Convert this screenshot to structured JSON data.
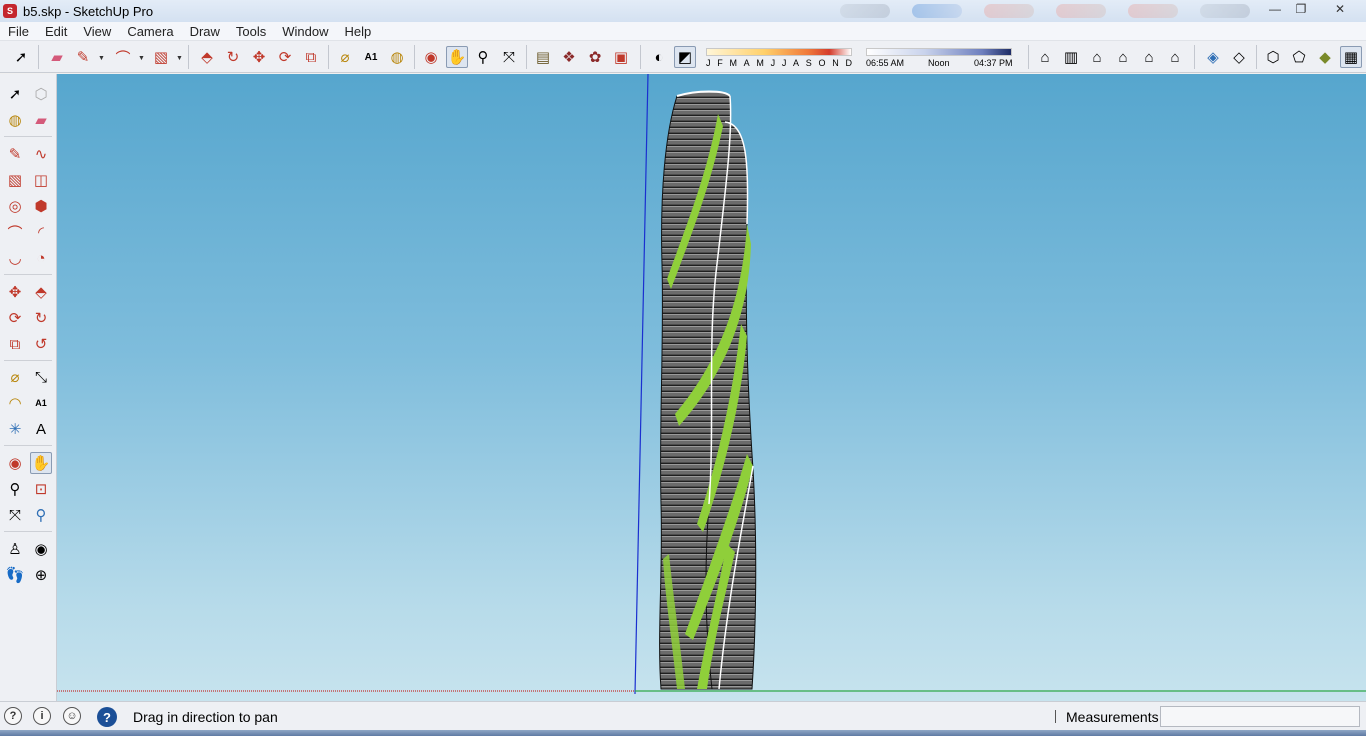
{
  "window": {
    "title": "b5.skp - SketchUp Pro",
    "app_icon": "sketchup-icon",
    "controls": [
      "minimize-icon",
      "restore-icon",
      "close-icon"
    ]
  },
  "menu": {
    "items": [
      "File",
      "Edit",
      "View",
      "Camera",
      "Draw",
      "Tools",
      "Window",
      "Help"
    ]
  },
  "toolbar": {
    "tools": [
      "select-icon",
      "eraser-icon",
      "pencil-icon",
      "arc-icon",
      "rectangle-icon",
      "push-pull-icon",
      "follow-me-icon",
      "move-icon",
      "rotate-icon",
      "scale-icon",
      "tape-measure-icon",
      "text-icon",
      "paint-bucket-icon",
      "orbit-icon",
      "pan-icon",
      "zoom-icon",
      "zoom-extents-icon",
      "3d-warehouse-icon",
      "components-icon",
      "extension-warehouse-icon",
      "layout-icon",
      "display-shadows-icon",
      "display-fog-icon",
      "iso-view-icon",
      "top-view-icon",
      "front-view-icon",
      "right-view-icon",
      "back-view-icon",
      "left-view-icon",
      "xray-icon",
      "back-edges-icon",
      "wireframe-icon",
      "hidden-line-icon",
      "shaded-icon",
      "shaded-textures-icon"
    ],
    "active_tool": "pan-icon"
  },
  "shadow_settings": {
    "months": [
      "J",
      "F",
      "M",
      "A",
      "M",
      "J",
      "J",
      "A",
      "S",
      "O",
      "N",
      "D"
    ],
    "time_start": "06:55 AM",
    "time_mid": "Noon",
    "time_end": "04:37 PM"
  },
  "left_toolbar": {
    "tools": [
      "select-icon",
      "make-component-icon",
      "paint-bucket-icon",
      "eraser-icon",
      "line-icon",
      "freehand-icon",
      "rectangle-icon",
      "rotated-rectangle-icon",
      "circle-icon",
      "polygon-icon",
      "arc-icon",
      "two-point-arc-icon",
      "three-point-arc-icon",
      "pie-icon",
      "move-icon",
      "push-pull-icon",
      "rotate-icon",
      "follow-me-icon",
      "scale-icon",
      "offset-icon",
      "tape-measure-icon",
      "dimension-icon",
      "protractor-icon",
      "text-icon",
      "axes-icon",
      "3d-text-icon",
      "orbit-icon",
      "pan-icon",
      "zoom-icon",
      "zoom-window-icon",
      "zoom-extents-icon",
      "previous-view-icon",
      "position-camera-icon",
      "look-around-icon",
      "walk-icon",
      "section-plane-icon"
    ],
    "active_tool": "pan-icon"
  },
  "status": {
    "message": "Drag in direction to pan",
    "measurements_label": "Measurements",
    "measurements_value": ""
  },
  "colors": {
    "sky_top": "#56a6ce",
    "sky_bottom": "#c7e3ee",
    "building_gray": "#6e6e6e",
    "building_green": "#8fcf3a",
    "axis_blue": "#1a2fd0",
    "axis_red": "#c43232",
    "axis_green": "#2fa84a"
  }
}
